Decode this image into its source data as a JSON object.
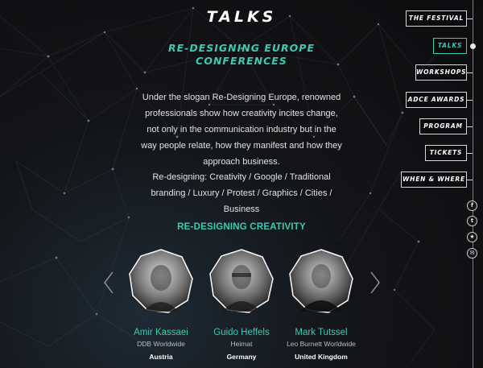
{
  "page": {
    "title": "TALKS",
    "subtitle": "RE-DESIGNING EUROPE CONFERENCES",
    "intro": "Under the slogan Re-Designing Europe, renowned professionals show how creativity incites change, not only in the communication industry but in the way people relate, how they manifest and how they approach business.",
    "tags": "Re-designing: Creativity / Google / Traditional branding / Luxury / Protest / Graphics / Cities / Business",
    "section_title": "RE-DESIGNING CREATIVITY"
  },
  "speakers": [
    {
      "name": "Amir Kassaei",
      "agency": "DDB Worldwide",
      "country": "Austria"
    },
    {
      "name": "Guido Heffels",
      "agency": "Heimat",
      "country": "Germany"
    },
    {
      "name": "Mark Tutssel",
      "agency": "Leo Burnett Worldwide",
      "country": "United Kingdom"
    }
  ],
  "carousel": {
    "prev_icon": "chevron-left-icon",
    "next_icon": "chevron-right-icon"
  },
  "nav": {
    "items": [
      {
        "label": "THE FESTIVAL",
        "active": false
      },
      {
        "label": "TALKS",
        "active": true
      },
      {
        "label": "WORKSHOPS",
        "active": false
      },
      {
        "label": "ADCE AWARDS",
        "active": false
      },
      {
        "label": "PROGRAM",
        "active": false
      },
      {
        "label": "TICKETS",
        "active": false
      },
      {
        "label": "WHEN & WHERE",
        "active": false
      }
    ]
  },
  "social": [
    {
      "icon": "facebook-icon",
      "glyph": "f"
    },
    {
      "icon": "twitter-icon",
      "glyph": "t"
    },
    {
      "icon": "star-icon",
      "glyph": "★"
    },
    {
      "icon": "mail-icon",
      "glyph": "✉"
    }
  ],
  "colors": {
    "accent": "#3ec9b3",
    "background": "#121417",
    "text": "#e6e6e6"
  }
}
